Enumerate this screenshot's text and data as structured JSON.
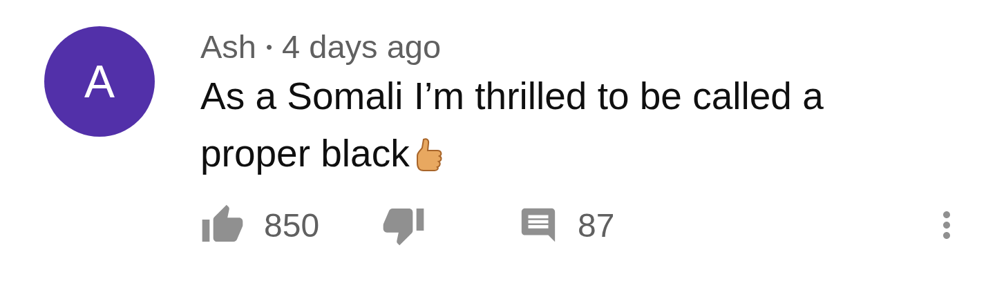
{
  "comment": {
    "avatar_letter": "A",
    "author": "Ash",
    "separator": "•",
    "time": "4 days ago",
    "text_lines": [
      "As a Somali I’m thrilled to be called a",
      "proper black"
    ],
    "likes": "850",
    "replies": "87"
  }
}
